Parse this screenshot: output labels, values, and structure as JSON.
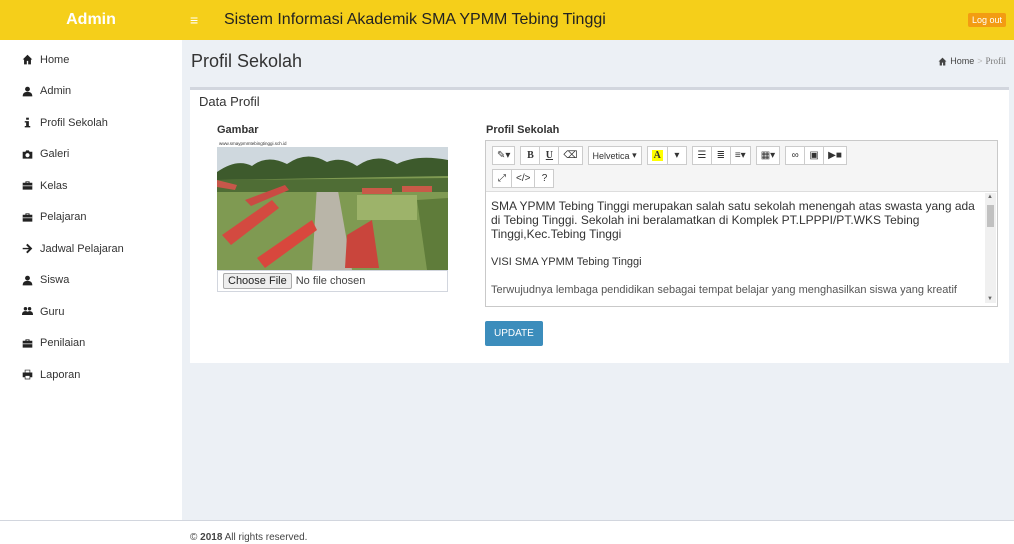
{
  "sidebar": {
    "brand": "Admin",
    "items": [
      {
        "label": "Home",
        "icon": "home-icon"
      },
      {
        "label": "Admin",
        "icon": "user-icon"
      },
      {
        "label": "Profil Sekolah",
        "icon": "info-icon"
      },
      {
        "label": "Galeri",
        "icon": "camera-icon"
      },
      {
        "label": "Kelas",
        "icon": "briefcase-icon"
      },
      {
        "label": "Pelajaran",
        "icon": "briefcase-icon"
      },
      {
        "label": "Jadwal Pelajaran",
        "icon": "arrow-right-icon"
      },
      {
        "label": "Siswa",
        "icon": "user-icon"
      },
      {
        "label": "Guru",
        "icon": "users-icon"
      },
      {
        "label": "Penilaian",
        "icon": "briefcase-icon"
      },
      {
        "label": "Laporan",
        "icon": "print-icon"
      }
    ]
  },
  "topbar": {
    "menu_icon": "≡",
    "title": "Sistem Informasi Akademik SMA YPMM Tebing Tinggi",
    "logout_label": "Log out"
  },
  "header": {
    "page_title": "Profil Sekolah",
    "breadcrumb_home": "Home",
    "breadcrumb_sep": ">",
    "breadcrumb_current": "Profil"
  },
  "box": {
    "title": "Data Profil",
    "image_label": "Gambar",
    "image_watermark": "www.smaypmmtebingtinggi.sch.id",
    "choose_file_label": "Choose File",
    "file_status": "No file chosen",
    "profil_label": "Profil Sekolah",
    "editor": {
      "font_name": "Helvetica",
      "highlight_letter": "A",
      "paragraph1": "SMA YPMM Tebing Tinggi merupakan salah satu sekolah menengah atas swasta yang ada di Tebing Tinggi. Sekolah ini beralamatkan di Komplek PT.LPPPI/PT.WKS Tebing Tinggi,Kec.Tebing Tinggi",
      "paragraph2": "VISI SMA YPMM Tebing Tinggi",
      "paragraph3": "Terwujudnya lembaga pendidikan sebagai tempat belajar yang menghasilkan siswa yang kreatif"
    },
    "update_label": "UPDATE"
  },
  "footer": {
    "copyright": "©",
    "year": "2018",
    "text": "All rights reserved."
  },
  "colors": {
    "brand": "#f5cf1a",
    "logout": "#f39c12",
    "primary": "#3c8dbc",
    "content_bg": "#ecf0f5"
  }
}
